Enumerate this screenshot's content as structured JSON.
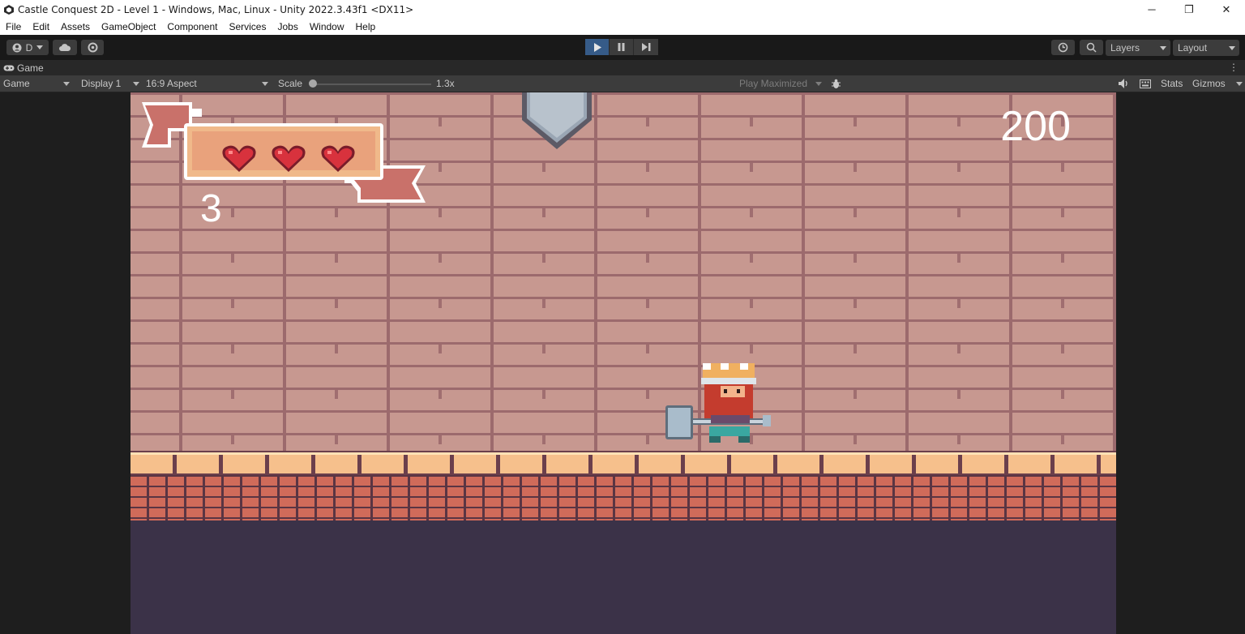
{
  "window": {
    "title": "Castle Conquest 2D - Level 1 - Windows, Mac, Linux - Unity 2022.3.43f1 <DX11>",
    "minimize": "─",
    "restore": "❐",
    "close": "✕"
  },
  "menu": [
    "File",
    "Edit",
    "Assets",
    "GameObject",
    "Component",
    "Services",
    "Jobs",
    "Window",
    "Help"
  ],
  "toolbar": {
    "account_label": "D",
    "layers_label": "Layers",
    "layout_label": "Layout"
  },
  "tab": {
    "label": "Game",
    "more": "⋮"
  },
  "gamebar": {
    "view_mode": "Game",
    "display": "Display 1",
    "aspect": "16:9 Aspect",
    "scale_label": "Scale",
    "scale_value": "1.3x",
    "play_mode": "Play Maximized",
    "stats": "Stats",
    "gizmos": "Gizmos"
  },
  "hud": {
    "lives": "3",
    "score": "200",
    "hearts": 3
  },
  "colors": {
    "play_active": "#365b88",
    "wall": "#c79890",
    "floor_tile": "#f6c08c"
  }
}
